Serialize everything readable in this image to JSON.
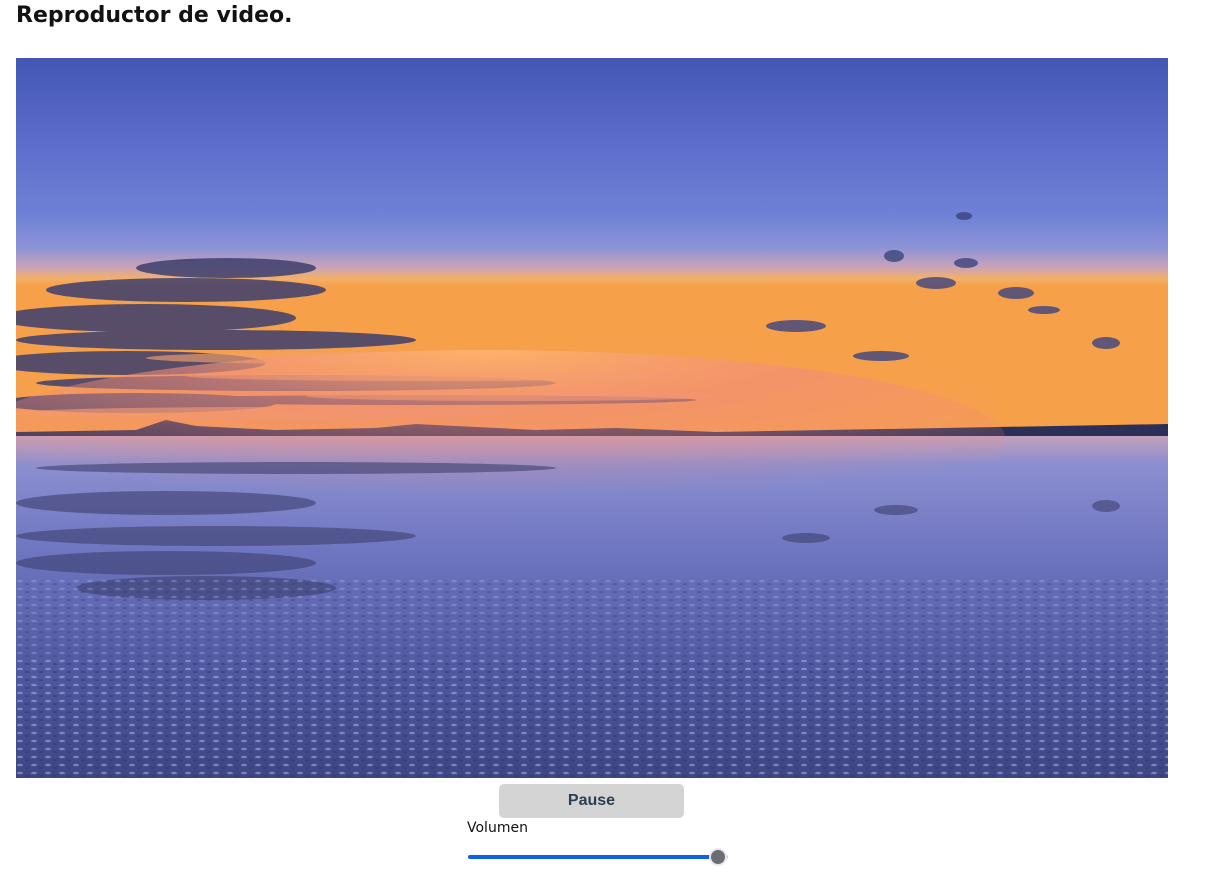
{
  "page": {
    "title": "Reproductor de video."
  },
  "video": {
    "scene": "sunset-salt-flat-reflection"
  },
  "controls": {
    "pause_label": "Pause",
    "volume_label": "Volumen",
    "volume_level": 1.0
  },
  "colors": {
    "slider_fill": "#0b63e5",
    "slider_thumb": "#6b6d75",
    "button_bg": "#d4d4d4",
    "button_text": "#2c3e50"
  }
}
